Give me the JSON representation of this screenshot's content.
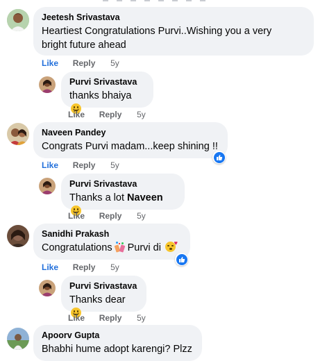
{
  "colors": {
    "bubble_bg": "#f0f2f5",
    "like_active": "#216fdb",
    "action_gray": "#65676b",
    "reaction_blue": "#1877f2"
  },
  "actions": {
    "like": "Like",
    "reply": "Reply"
  },
  "comments": [
    {
      "author": "Jeetesh Srivastava",
      "text_line1": "Heartiest Congratulations Purvi..Wishing you a very",
      "text_line2": "bright future ahead",
      "time": "5y",
      "liked": true,
      "avatar_icon": "profile-photo",
      "reply": {
        "author": "Purvi Srivastava",
        "text": "thanks bhaiya",
        "emoji": "slightly-smiling-face-emoji",
        "time": "5y"
      }
    },
    {
      "author": "Naveen Pandey",
      "text": "Congrats Purvi madam...keep shining !!",
      "time": "5y",
      "liked": true,
      "reaction": "like-reaction-icon",
      "reply": {
        "author": "Purvi Srivastava",
        "text_prefix": "Thanks a lot",
        "text_bold": "Naveen",
        "emoji": "slightly-smiling-face-emoji",
        "time": "5y"
      }
    },
    {
      "author": "Sanidhi Prakash",
      "text_prefix": "Congratulations",
      "text_suffix": "Purvi di",
      "emoji_mid": "confetti-ball-emoji",
      "emoji_end": "face-blowing-a-kiss-emoji",
      "time": "5y",
      "liked": true,
      "reaction": "like-reaction-icon",
      "reply": {
        "author": "Purvi Srivastava",
        "text": "Thanks dear",
        "emoji": "slightly-smiling-face-emoji",
        "time": "5y"
      }
    },
    {
      "author": "Apoorv Gupta",
      "text": "Bhabhi hume adopt karengi? Plzz"
    }
  ]
}
